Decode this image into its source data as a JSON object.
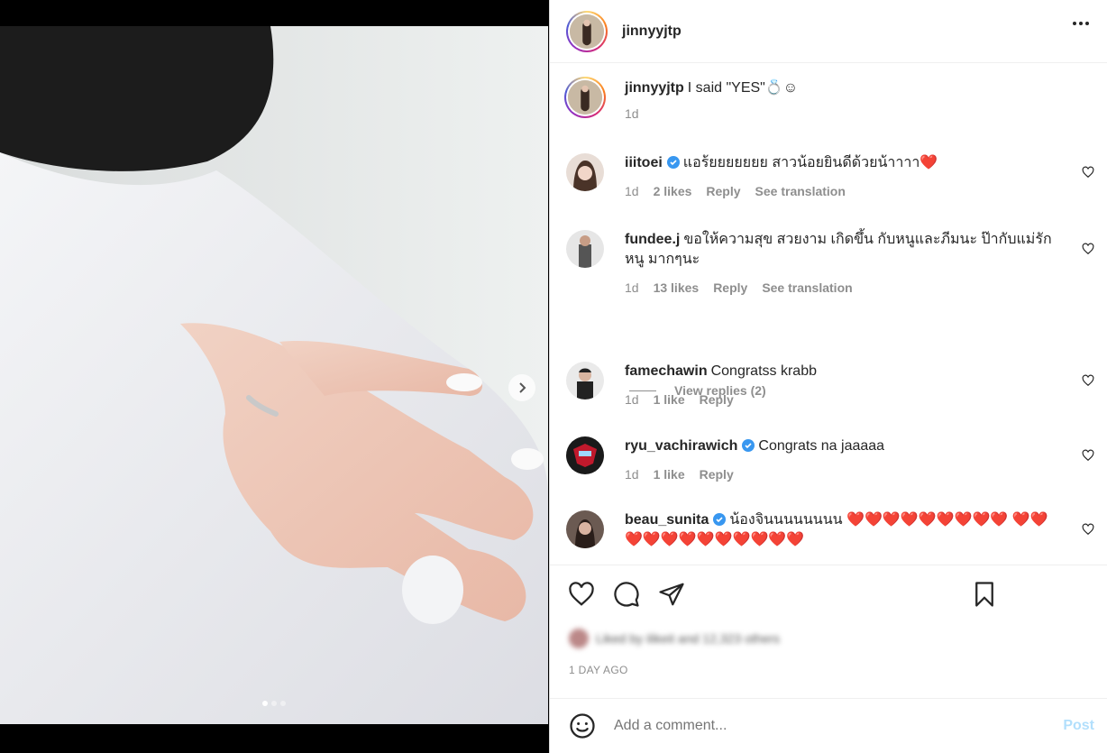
{
  "post": {
    "username": "jinnyyjtp",
    "caption": "I said \"YES\"💍☺",
    "caption_time": "1d",
    "time_ago": "1 DAY AGO",
    "likes_text": "Liked by ilikeit and 12,323 others",
    "media_dots": 3,
    "media_active_index": 0
  },
  "comments": [
    {
      "username": "iiitoei",
      "verified": true,
      "text": "แอร้ยยยยยยย สาวน้อยยินดีด้วยน้าาาา❤️",
      "time": "1d",
      "likes": "2 likes",
      "reply": "Reply",
      "translate": "See translation"
    },
    {
      "username": "fundee.j",
      "verified": false,
      "text": "ขอให้ความสุข สวยงาม เกิดขึ้น กับหนูและภีมนะ ป๊ากับแม่รักหนู มากๆนะ",
      "time": "1d",
      "likes": "13 likes",
      "reply": "Reply",
      "translate": "See translation"
    },
    {
      "username": "famechawin",
      "verified": false,
      "text": "Congratss krabb",
      "time": "1d",
      "likes": "1 like",
      "reply": "Reply"
    },
    {
      "username": "ryu_vachirawich",
      "verified": true,
      "text": "Congrats na jaaaaa",
      "time": "1d",
      "likes": "1 like",
      "reply": "Reply"
    },
    {
      "username": "beau_sunita",
      "verified": true,
      "text": "น้องจินนนนนนนน ❤️❤️❤️❤️❤️❤️❤️❤️❤️ ❤️❤️❤️❤️❤️❤️❤️❤️❤️❤️❤️❤️"
    }
  ],
  "view_replies": "View replies (2)",
  "add_comment": {
    "placeholder": "Add a comment...",
    "post_label": "Post"
  },
  "icons": {
    "more": "more-options-icon",
    "like": "heart-icon",
    "comment": "comment-icon",
    "share": "send-icon",
    "save": "bookmark-icon",
    "emoji": "emoji-icon",
    "next": "chevron-right-icon"
  },
  "colors": {
    "verified": "#3897f0",
    "link_disabled": "#b2dffc",
    "muted": "#8e8e8e"
  }
}
